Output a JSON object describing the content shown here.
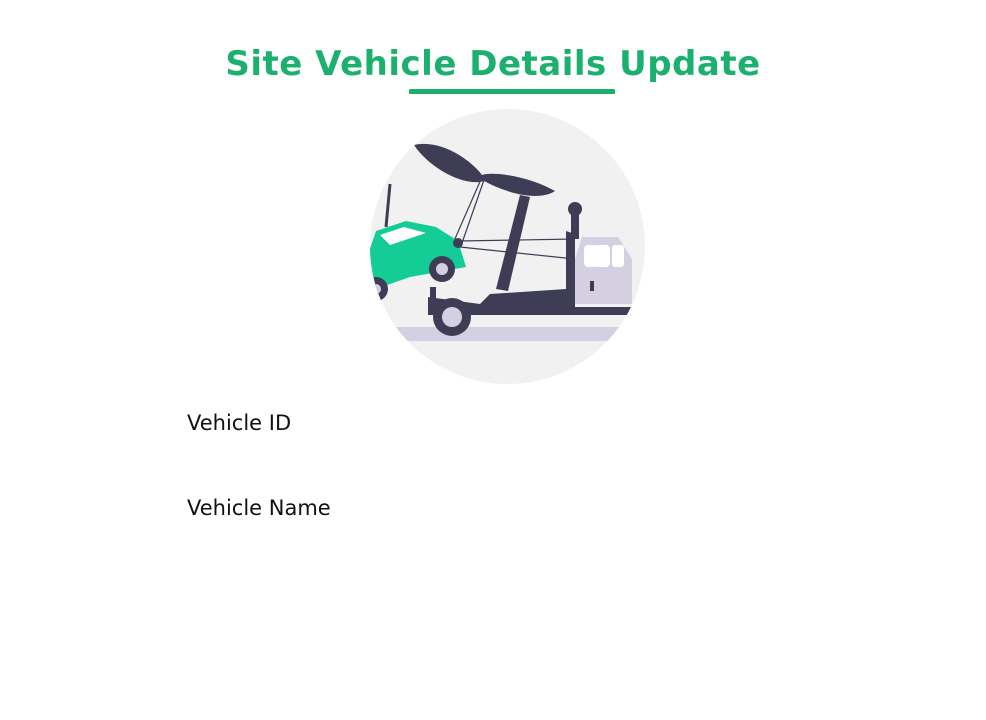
{
  "page": {
    "title": "Site Vehicle Details Update",
    "accent_color": "#1bb06e"
  },
  "illustration": {
    "icon": "tow-truck-illustration"
  },
  "form": {
    "vehicle_id_label": "Vehicle ID",
    "vehicle_name_label": "Vehicle Name"
  }
}
